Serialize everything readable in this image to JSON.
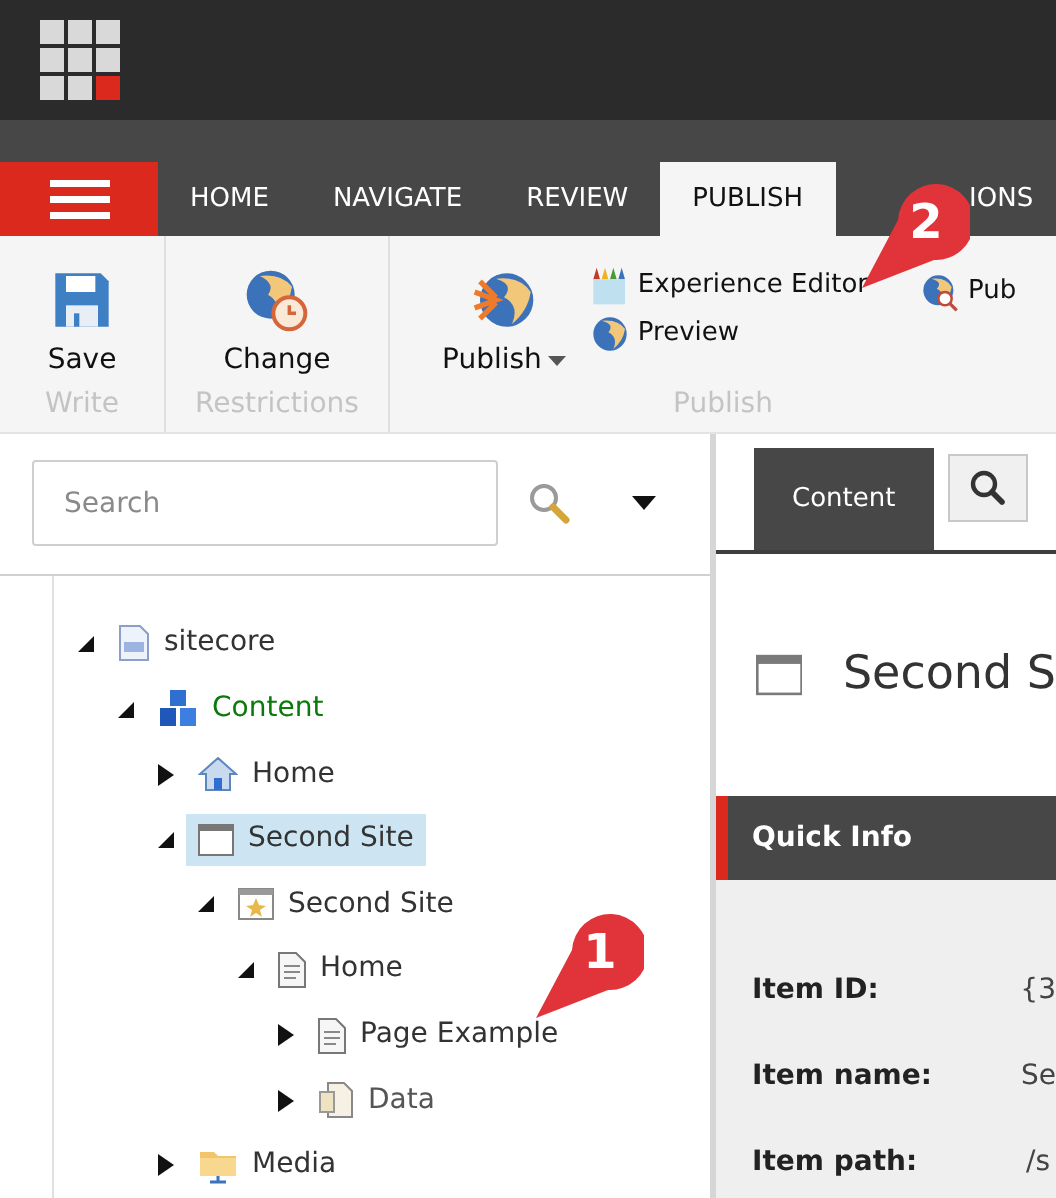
{
  "main_tabs": [
    {
      "label": "HOME",
      "selected": false
    },
    {
      "label": "NAVIGATE",
      "selected": false
    },
    {
      "label": "REVIEW",
      "selected": false
    },
    {
      "label": "PUBLISH",
      "selected": true
    },
    {
      "label": "IONS",
      "selected": false
    }
  ],
  "ribbon": {
    "groups": [
      {
        "label": "Write",
        "buttons": [
          {
            "kind": "save",
            "label": "Save"
          }
        ]
      },
      {
        "label": "Restrictions",
        "buttons": [
          {
            "kind": "change",
            "label": "Change"
          }
        ]
      },
      {
        "label": "Publish",
        "buttons": [
          {
            "kind": "publish",
            "label": "Publish"
          },
          {
            "kind": "experience",
            "label": "Experience Editor"
          },
          {
            "kind": "preview",
            "label": "Preview"
          },
          {
            "kind": "pub",
            "label": "Pub"
          }
        ]
      }
    ]
  },
  "search": {
    "placeholder": "Search"
  },
  "tree": [
    {
      "label": "sitecore",
      "kind": "page",
      "expanded": true,
      "selected": false,
      "color": "#333333",
      "children": [
        {
          "label": "Content",
          "kind": "content",
          "expanded": true,
          "selected": false,
          "color": "#0a7a0a",
          "children": [
            {
              "label": "Home",
              "kind": "home",
              "expanded": false,
              "selected": false,
              "color": "#333333"
            },
            {
              "label": "Second Site",
              "kind": "window",
              "expanded": true,
              "selected": true,
              "color": "#333333",
              "children": [
                {
                  "label": "Second Site",
                  "kind": "site",
                  "expanded": true,
                  "selected": false,
                  "color": "#333333",
                  "children": [
                    {
                      "label": "Home",
                      "kind": "doc",
                      "expanded": true,
                      "selected": false,
                      "color": "#333333",
                      "children": [
                        {
                          "label": "Page Example",
                          "kind": "doc",
                          "expanded": false,
                          "selected": false,
                          "color": "#333333"
                        },
                        {
                          "label": "Data",
                          "kind": "data",
                          "expanded": false,
                          "selected": false,
                          "color": "#555555"
                        }
                      ]
                    }
                  ]
                }
              ]
            },
            {
              "label": "Media",
              "kind": "folder",
              "expanded": false,
              "selected": false,
              "color": "#333333"
            }
          ]
        }
      ]
    }
  ],
  "editor_tabs": [
    {
      "kind": "text",
      "label": "Content",
      "selected": true
    },
    {
      "kind": "search",
      "selected": false
    }
  ],
  "item_title": "Second S",
  "section_title": "Quick Info",
  "fields": [
    {
      "label": "Item ID:",
      "value": "{3"
    },
    {
      "label": "Item name:",
      "value": "Se"
    },
    {
      "label": "Item path:",
      "value": "/s"
    }
  ],
  "callouts": [
    {
      "number": "1"
    },
    {
      "number": "2"
    }
  ]
}
